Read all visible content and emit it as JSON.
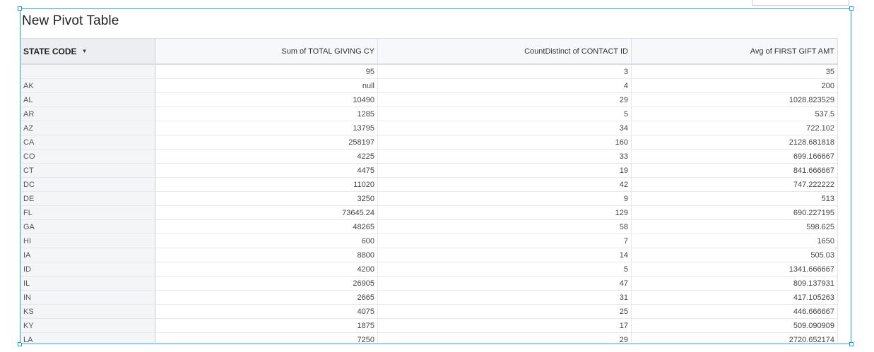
{
  "title": "New Pivot Table",
  "columns": {
    "state": "STATE CODE",
    "sum": "Sum of TOTAL GIVING CY",
    "count": "CountDistinct of CONTACT ID",
    "avg": "Avg of FIRST GIFT AMT"
  },
  "icons": {
    "sort": "chevron-down-icon"
  },
  "colors": {
    "accent": "#1aa0d9"
  },
  "rows": [
    {
      "state": "",
      "sum": "95",
      "count": "3",
      "avg": "35"
    },
    {
      "state": "AK",
      "sum": "null",
      "count": "4",
      "avg": "200"
    },
    {
      "state": "AL",
      "sum": "10490",
      "count": "29",
      "avg": "1028.823529"
    },
    {
      "state": "AR",
      "sum": "1285",
      "count": "5",
      "avg": "537.5"
    },
    {
      "state": "AZ",
      "sum": "13795",
      "count": "34",
      "avg": "722.102"
    },
    {
      "state": "CA",
      "sum": "258197",
      "count": "160",
      "avg": "2128.681818"
    },
    {
      "state": "CO",
      "sum": "4225",
      "count": "33",
      "avg": "699.166667"
    },
    {
      "state": "CT",
      "sum": "4475",
      "count": "19",
      "avg": "841.666667"
    },
    {
      "state": "DC",
      "sum": "11020",
      "count": "42",
      "avg": "747.222222"
    },
    {
      "state": "DE",
      "sum": "3250",
      "count": "9",
      "avg": "513"
    },
    {
      "state": "FL",
      "sum": "73645.24",
      "count": "129",
      "avg": "690.227195"
    },
    {
      "state": "GA",
      "sum": "48265",
      "count": "58",
      "avg": "598.625"
    },
    {
      "state": "HI",
      "sum": "600",
      "count": "7",
      "avg": "1650"
    },
    {
      "state": "IA",
      "sum": "8800",
      "count": "14",
      "avg": "505.03"
    },
    {
      "state": "ID",
      "sum": "4200",
      "count": "5",
      "avg": "1341.666667"
    },
    {
      "state": "IL",
      "sum": "26905",
      "count": "47",
      "avg": "809.137931"
    },
    {
      "state": "IN",
      "sum": "2665",
      "count": "31",
      "avg": "417.105263"
    },
    {
      "state": "KS",
      "sum": "4075",
      "count": "25",
      "avg": "446.666667"
    },
    {
      "state": "KY",
      "sum": "1875",
      "count": "17",
      "avg": "509.090909"
    },
    {
      "state": "LA",
      "sum": "7250",
      "count": "29",
      "avg": "2720.652174"
    }
  ]
}
